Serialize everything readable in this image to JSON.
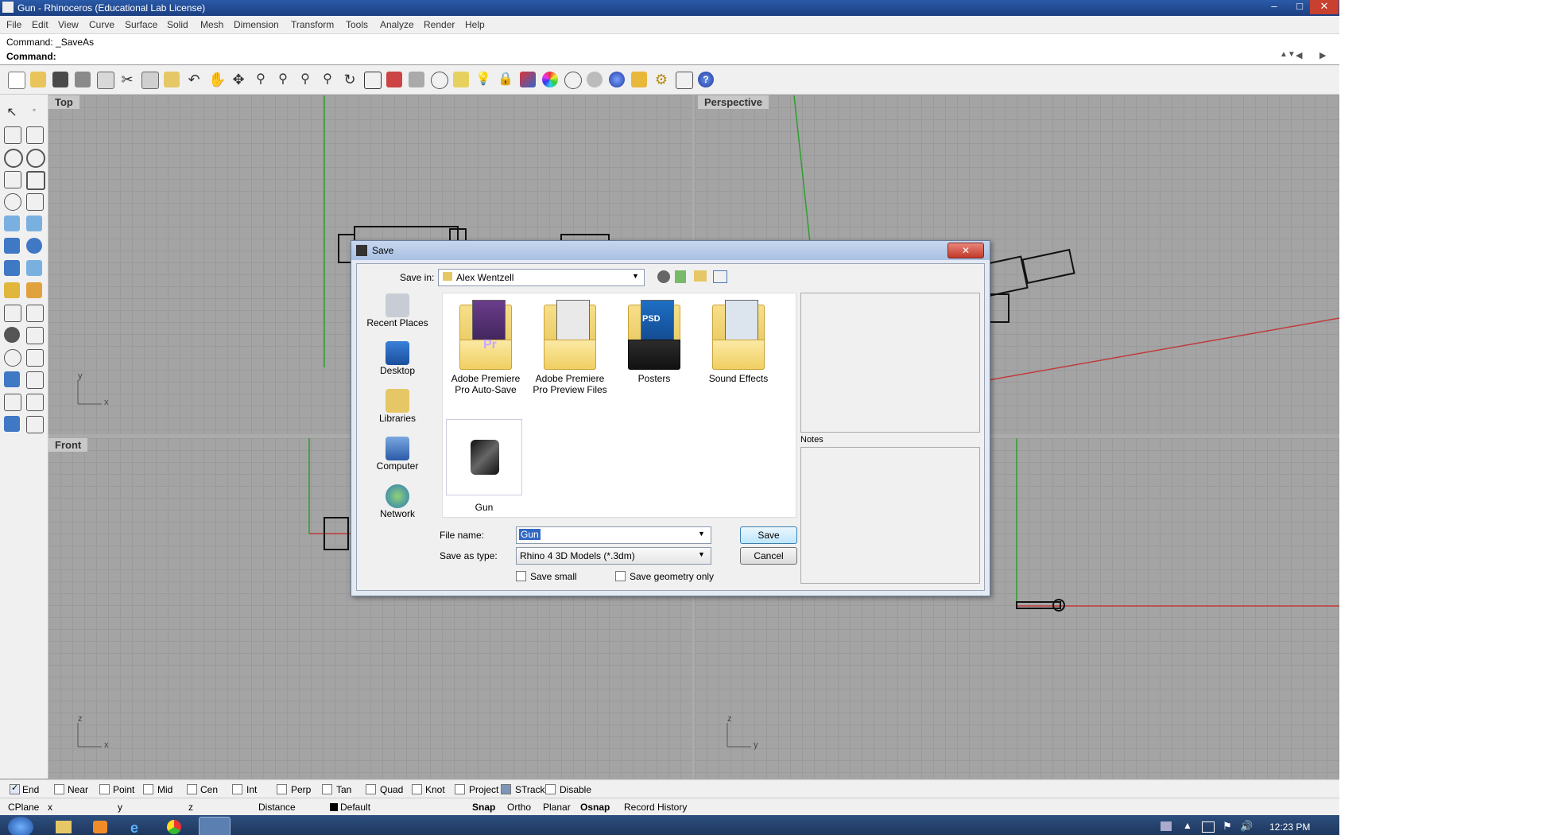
{
  "window": {
    "title": "Gun - Rhinoceros (Educational Lab License)",
    "min": "–",
    "max": "□",
    "close": "✕"
  },
  "menu": [
    "File",
    "Edit",
    "View",
    "Curve",
    "Surface",
    "Solid",
    "Mesh",
    "Dimension",
    "Transform",
    "Tools",
    "Analyze",
    "Render",
    "Help"
  ],
  "command": {
    "history": "Command: _SaveAs",
    "prompt": "Command:"
  },
  "viewports": {
    "top": "Top",
    "perspective": "Perspective",
    "front": "Front",
    "axis_x": "x",
    "axis_y": "y",
    "axis_z": "z"
  },
  "dialog": {
    "title": "Save",
    "save_in_label": "Save in:",
    "save_in_value": "Alex Wentzell",
    "places": [
      "Recent Places",
      "Desktop",
      "Libraries",
      "Computer",
      "Network"
    ],
    "files": [
      {
        "name": "Adobe Premiere Pro Auto-Save",
        "type": "folder",
        "badge": "Pr"
      },
      {
        "name": "Adobe Premiere Pro Preview Files",
        "type": "folder",
        "badge": ""
      },
      {
        "name": "Posters",
        "type": "folder",
        "badge": "PSD"
      },
      {
        "name": "Sound Effects",
        "type": "folder",
        "badge": ""
      },
      {
        "name": "Gun",
        "type": "file",
        "badge": ""
      }
    ],
    "file_name_label": "File name:",
    "file_name_value": "Gun",
    "save_type_label": "Save as type:",
    "save_type_value": "Rhino 4 3D Models (*.3dm)",
    "save_button": "Save",
    "cancel_button": "Cancel",
    "save_small": "Save small",
    "save_geometry_only": "Save geometry only",
    "notes_label": "Notes"
  },
  "osnaps": [
    {
      "label": "End",
      "checked": true
    },
    {
      "label": "Near",
      "checked": false
    },
    {
      "label": "Point",
      "checked": false
    },
    {
      "label": "Mid",
      "checked": false
    },
    {
      "label": "Cen",
      "checked": false
    },
    {
      "label": "Int",
      "checked": false
    },
    {
      "label": "Perp",
      "checked": false
    },
    {
      "label": "Tan",
      "checked": false
    },
    {
      "label": "Quad",
      "checked": false
    },
    {
      "label": "Knot",
      "checked": false
    },
    {
      "label": "Project",
      "checked": false
    },
    {
      "label": "STrack",
      "checked": false
    },
    {
      "label": "Disable",
      "checked": false
    }
  ],
  "status": {
    "cplane": "CPlane",
    "x": "x",
    "y": "y",
    "z": "z",
    "distance": "Distance",
    "layer": "Default",
    "snap": "Snap",
    "ortho": "Ortho",
    "planar": "Planar",
    "osnap": "Osnap",
    "record": "Record History"
  },
  "taskbar": {
    "time": "12:23 PM"
  },
  "colors": {
    "xaxis": "#c23a3a",
    "yaxis": "#2e9e2e",
    "accent": "#2f5fa8"
  }
}
